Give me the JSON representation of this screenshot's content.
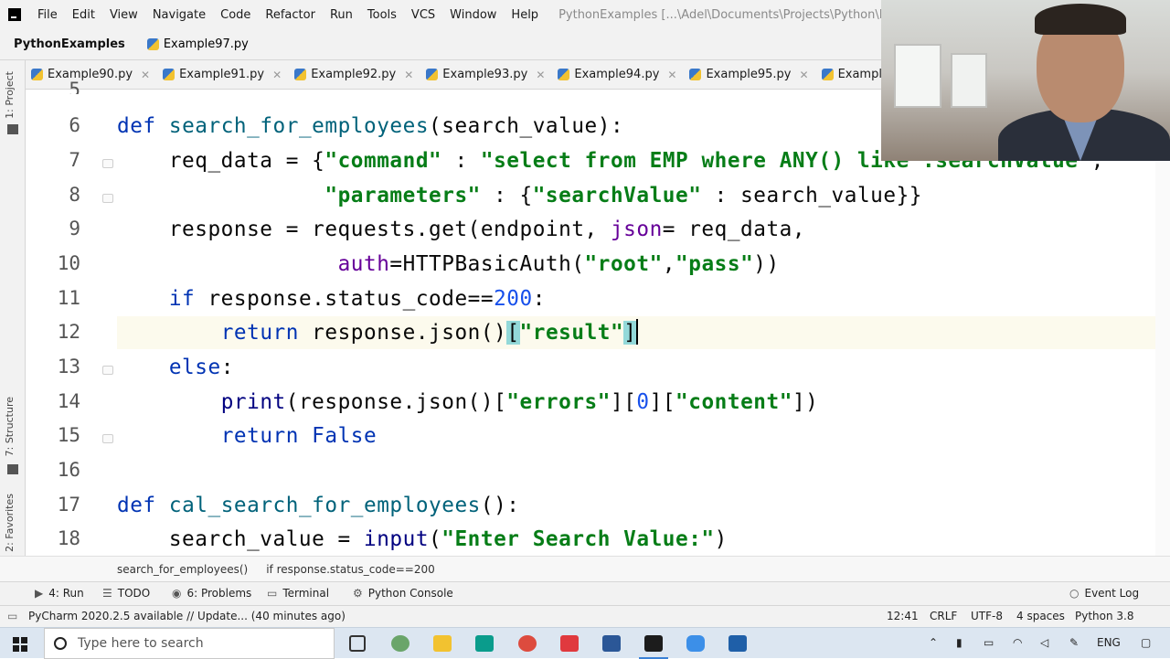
{
  "menubar": {
    "items": [
      "File",
      "Edit",
      "View",
      "Navigate",
      "Code",
      "Refactor",
      "Run",
      "Tools",
      "VCS",
      "Window",
      "Help"
    ],
    "title": "PythonExamples [...\\Adel\\Documents\\Projects\\Python\\Python105\\Pyth"
  },
  "navbar": {
    "project": "PythonExamples",
    "file": "Example97.py"
  },
  "tabs": [
    "Example90.py",
    "Example91.py",
    "Example92.py",
    "Example93.py",
    "Example94.py",
    "Example95.py",
    "Example96.py"
  ],
  "left_strip": {
    "project": "1: Project",
    "structure": "7: Structure",
    "favorites": "2: Favorites"
  },
  "editor": {
    "line_numbers": [
      "5",
      "6",
      "7",
      "8",
      "9",
      "10",
      "11",
      "12",
      "13",
      "14",
      "15",
      "16",
      "17",
      "18"
    ],
    "current_line": "12"
  },
  "breadcrumbs": [
    "search_for_employees()",
    "if response.status_code==200"
  ],
  "toolwindows": {
    "run": "4: Run",
    "todo": "TODO",
    "problems": "6: Problems",
    "terminal": "Terminal",
    "console": "Python Console",
    "event_log": "Event Log"
  },
  "statusbar": {
    "message": "PyCharm 2020.2.5 available // Update... (40 minutes ago)",
    "position": "12:41",
    "line_sep": "CRLF",
    "encoding": "UTF-8",
    "indent": "4 spaces",
    "interpreter": "Python 3.8"
  },
  "taskbar": {
    "search_placeholder": "Type here to search",
    "lang": "ENG"
  }
}
